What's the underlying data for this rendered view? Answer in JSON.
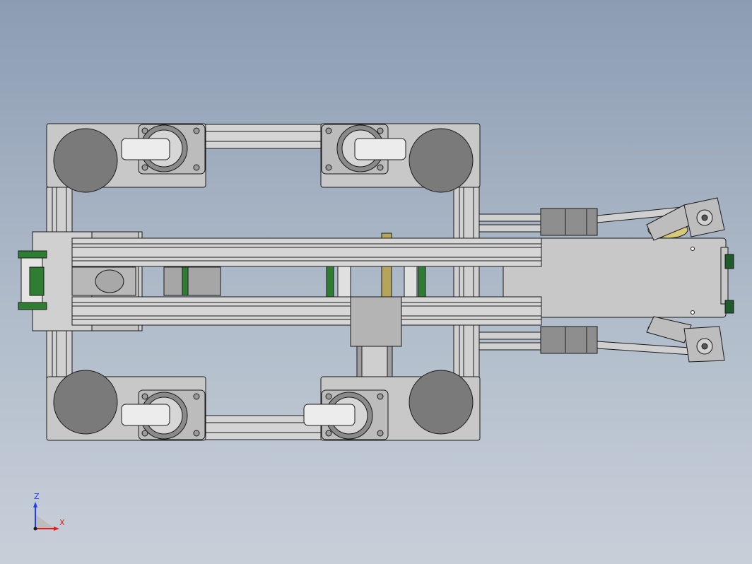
{
  "view": {
    "background_top": "#8c9db3",
    "background_bottom": "#c8cfd9",
    "part_fill": "#c8c8c8",
    "rail_fill": "#d4d4d4",
    "wheel_fill": "#7a7a7a",
    "edge_color": "#1a1a1a",
    "accent_green": "#2e7d32",
    "accent_yellow": "#d6c97a"
  },
  "triad": {
    "z_label": "Z",
    "x_label": "X",
    "z_color": "#1e3cff",
    "x_color": "#e02020"
  }
}
